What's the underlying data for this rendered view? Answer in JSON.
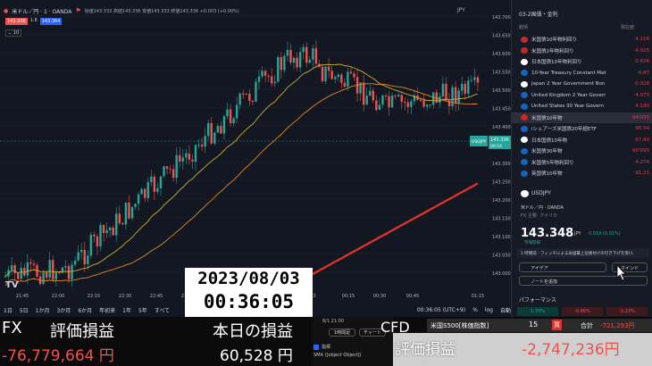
{
  "topbar": {
    "symbol": "米ドル／円 · 1 · OANDA",
    "ohlc": "始値143.333 高値143.336 安値143.333 終値143.336 +0.003 (+0.00%)",
    "sell": "143.336",
    "spread": "1.8",
    "buy": "143.364",
    "indicator_count": "10",
    "currency": "JPY"
  },
  "price_axis": [
    "143.700",
    "143.650",
    "143.600",
    "143.550",
    "143.500",
    "143.450",
    "143.400",
    "143.350",
    "143.300",
    "143.250",
    "143.200",
    "143.150",
    "143.100",
    "143.050",
    "143.000"
  ],
  "price_tag": {
    "symbol": "USDJPY",
    "price": "143.336",
    "countdown": "00:54"
  },
  "time_axis": [
    "21:45",
    "22:00",
    "22:15",
    "22:30",
    "22:45",
    "23:00",
    "23:15",
    "23:30",
    "23:45",
    "3",
    "00:15",
    "00:30",
    "00:45",
    "01:15"
  ],
  "timebar": {
    "ranges": [
      "1日",
      "5日",
      "1か月",
      "3か月",
      "6か月",
      "年初来",
      "1年",
      "5年",
      "すべて"
    ],
    "clock": "00:36:05 (UTC+9)",
    "flags": [
      "%",
      "log",
      "自動"
    ]
  },
  "watchlist": {
    "title": "03-2国債・金利",
    "col_symbol": "銘柄",
    "col_price": "現在値",
    "rows": [
      {
        "name": "米国債10年物利回り",
        "value": "4.116"
      },
      {
        "name": "米国債2年物利回り",
        "value": "4.925"
      },
      {
        "name": "日本国債10年物利回り",
        "value": "0.626"
      },
      {
        "name": "10-Year Treasury Constant Mat",
        "value": "-0.87"
      },
      {
        "name": "Japan 2 Year Government Bon",
        "value": "0.028"
      },
      {
        "name": "United Kingdom 2 Year Goverr",
        "value": "4.973"
      },
      {
        "name": "United States 30 Year Govern",
        "value": "4.199"
      },
      {
        "name": "米国債10年物",
        "value": "94'035"
      },
      {
        "name": "iシェアーズ米国債20年超ETF",
        "value": "96.54"
      },
      {
        "name": "日本国債10年物",
        "value": "97.90"
      },
      {
        "name": "米国債30年物",
        "value": "90'095"
      },
      {
        "name": "米国債5年物利回り",
        "value": "4.274"
      },
      {
        "name": "英国債10年物",
        "value": "91.21"
      }
    ]
  },
  "detail": {
    "symbol": "USDJPY",
    "name": "米ドル／円 · OANDA",
    "sub": "FX 主要: アメリカ",
    "price": "143.348",
    "unit": "JPY",
    "change": "0.019 (0.01%)",
    "status": "市場開場",
    "news": "1 時間前 · フィッチによる米国最上位格付けの引き下げを受け、",
    "idea_btn": "アイデア",
    "mind_btn": "マインド",
    "note_btn": "ノートを追加",
    "perf_title": "パフォーマンス",
    "perf": [
      "1.70%",
      "-0.66%",
      "-1.23%"
    ]
  },
  "overlay_date": "2023/08/03",
  "overlay_time": "00:36:05",
  "bottom": {
    "fx_label": "FX",
    "fx_pl_label": "評価損益",
    "fx_pl_value": "-76,779,664 円",
    "today_label": "本日の損益",
    "today_value": "60,528 円",
    "cfd_label": "CFD",
    "cfd_pl_label": "評価損益",
    "cfd_pl_value": "-2,747,236円",
    "cfd_symbol": "米国S500[株価指数]",
    "cfd_qty": "15",
    "cfd_side": "買",
    "cfd_total_label": "合計",
    "cfd_total": "-721,293円",
    "mini_time": "8/1 21:00",
    "mini_btn1": "1時間足",
    "mini_btn2": "チャート",
    "mini_text1": "指標",
    "mini_text2": "SMA ([object Object])"
  },
  "colors": {
    "up": "#26a69a",
    "down": "#ef5350",
    "ma_yellow": "#c9b037",
    "ma_orange": "#e08a2a",
    "ma_red": "#e8322b",
    "bg": "#131722"
  }
}
